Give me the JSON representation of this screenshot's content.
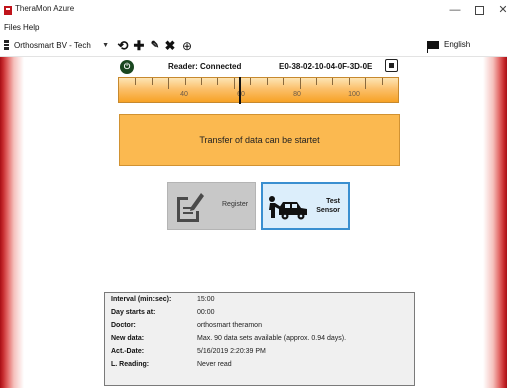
{
  "window": {
    "title": "TheraMon Azure",
    "minimize_glyph": "—",
    "close_glyph": "✕"
  },
  "menu": {
    "files": "Files",
    "help": "Help"
  },
  "toolbar": {
    "device_select": "Orthosmart BV - Tech",
    "language": "English",
    "icons": [
      "device-icon",
      "refresh-icon",
      "add-icon",
      "edit-icon",
      "delete-icon",
      "globe-icon",
      "flag-icon"
    ]
  },
  "reader": {
    "status": "Reader: Connected",
    "id": "E0-38-02-10-04-0F-3D-0E"
  },
  "gauge": {
    "labels": [
      "40",
      "60",
      "80",
      "100"
    ],
    "needle_value": 62
  },
  "status_message": "Transfer of data can be startet",
  "buttons": {
    "register": "Register",
    "test_line1": "Test",
    "test_line2": "Sensor"
  },
  "info": [
    {
      "label": "Interval (min:sec):",
      "value": "15:00"
    },
    {
      "label": "Day starts at:",
      "value": "00:00"
    },
    {
      "label": "Doctor:",
      "value": "orthosmart theramon"
    },
    {
      "label": "New data:",
      "value": "Max. 90  data sets available (approx. 0.94 days)."
    },
    {
      "label": "Act.-Date:",
      "value": "5/16/2019 2:20:39 PM"
    },
    {
      "label": "L. Reading:",
      "value": "Never read"
    }
  ],
  "colors": {
    "accent_red": "#c62a2d",
    "gauge_orange": "#f7a226",
    "status_orange": "#fbb950",
    "selected_blue": "#3a8fd0",
    "connected_green": "#1a4720"
  }
}
